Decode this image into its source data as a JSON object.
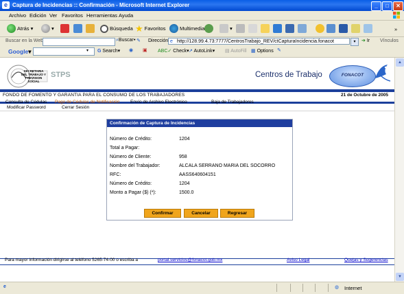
{
  "window": {
    "title": "Captura de Incidencias :: Confirmación - Microsoft Internet Explorer"
  },
  "menu": [
    "Archivo",
    "Edición",
    "Ver",
    "Favoritos",
    "Herramientas",
    "Ayuda"
  ],
  "toolbar": {
    "back": "Atrás",
    "search": "Búsqueda",
    "favorites": "Favoritos",
    "media": "Multimedia"
  },
  "address": {
    "search_label": "Buscar en la Web",
    "search_button": "Buscar",
    "label": "Dirección",
    "url": "http://128.99.4.73:7777/CentrosTrabajo_REV/ctCapturaIncidencia.fonacot",
    "go": "Ir",
    "links": "Vínculos"
  },
  "google": {
    "logo": "Google",
    "search": "Search",
    "check": "Check",
    "autolink": "AutoLink",
    "autofill": "AutoFill",
    "options": "Options"
  },
  "header": {
    "seal_text": "SECRETARIA DEL TRABAJO Y PREVISION SOCIAL",
    "stps": "STPS",
    "section_title": "Centros de Trabajo",
    "fonacot_logo": "FONACOT",
    "org_name": "FONDO DE FOMENTO Y GARANTIA PARA EL CONSUMO DE LOS TRABAJADORES",
    "date": "21 de Octubre de 2005"
  },
  "nav": {
    "row1": [
      "Consulta de Cédulas",
      "Pago de Cédulas de Notificación",
      "Envío de Archivo Electrónico",
      "Baja de Trabajadores"
    ],
    "row2": [
      "Modificar Password",
      "Cerrar Sesión"
    ]
  },
  "dialog": {
    "title": "Confirmación de Captura de Incidencias",
    "fields": [
      {
        "label": "Número de Crédito:",
        "value": "1204"
      },
      {
        "label": "Total a Pagar:",
        "value": ""
      },
      {
        "label": "Número de Cliente:",
        "value": "958"
      },
      {
        "label": "Nombre del Trabajador:",
        "value": "ALCALA SERRANO MARIA DEL SOCORRO"
      },
      {
        "label": "RFC:",
        "value": "AASS640604151"
      },
      {
        "label": "Número de Crédito:",
        "value": "1204"
      },
      {
        "label": "Monto a Pagar ($) (*):",
        "value": "1500.0"
      }
    ],
    "buttons": {
      "confirm": "Confirmar",
      "cancel": "Cancelar",
      "back": "Regresar"
    }
  },
  "footer": {
    "text": "Para mayor información dirigirse al teléfono 5265-74-00 o escriba a",
    "email": "portal.servicios@fonacot.gob.mx",
    "legal": "Aviso Legal",
    "complaints": "Quejas y Sugerencias"
  },
  "status": {
    "zone": "Internet"
  },
  "colors": {
    "nav_blue": "#1b3f9b",
    "button_orange": "#f0a51c",
    "link_blue": "#0000cc"
  }
}
